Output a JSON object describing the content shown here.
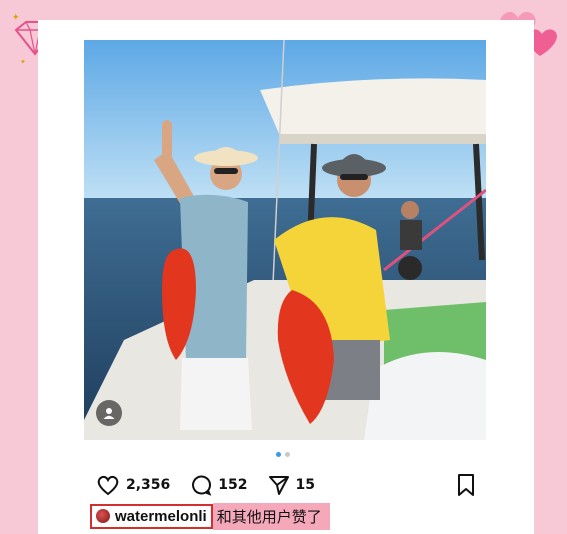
{
  "post": {
    "likes_count": "2,356",
    "comments_count": "152",
    "shares_count": "15",
    "liked_by_user": "watermelonli",
    "liked_by_rest": "和其他用户赞了"
  },
  "carousel": {
    "total": 2,
    "active_index": 0
  },
  "icons": {
    "like": "heart-icon",
    "comment": "comment-icon",
    "share": "send-icon",
    "save": "bookmark-icon",
    "tagged_user": "user-icon"
  },
  "colors": {
    "background": "#f7c9d6",
    "highlight": "#f6a8bb",
    "outline": "#d23030",
    "carousel_active": "#3897f0"
  }
}
